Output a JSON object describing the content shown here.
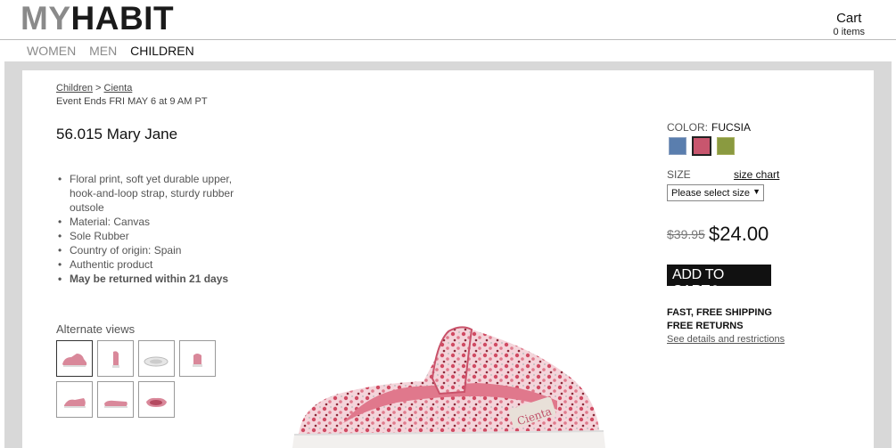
{
  "header": {
    "logo_my": "MY",
    "logo_habit": "HABIT",
    "cart_title": "Cart",
    "cart_count": "0 items"
  },
  "nav": [
    "WOMEN",
    "MEN",
    "CHILDREN"
  ],
  "nav_active": "CHILDREN",
  "breadcrumb": {
    "part1": "Children",
    "separator": " > ",
    "part2": "Cienta"
  },
  "event_ends": "Event Ends FRI MAY 6 at 9 AM PT",
  "product": {
    "title": "56.015 Mary Jane",
    "features": [
      "Floral print, soft yet durable upper, hook-and-loop strap, sturdy rubber outsole",
      "Material: Canvas",
      "Sole Rubber",
      "Country of origin: Spain",
      "Authentic product",
      "May be returned within 21 days"
    ],
    "alternate_views_label": "Alternate views",
    "brand_mark": "Cienta"
  },
  "purchase": {
    "color_label": "COLOR:",
    "color_value": "FUCSIA",
    "swatch_colors": [
      "#5a7eae",
      "#c8566e",
      "#8a9a40"
    ],
    "size_label": "SIZE",
    "size_chart": "size chart",
    "size_select": "Please select size",
    "old_price": "$39.95",
    "new_price": "$24.00",
    "add_to_cart": "ADD TO CART",
    "shipping_line1": "FAST, FREE SHIPPING",
    "shipping_line2": "FREE RETURNS",
    "details_link": "See details and restrictions"
  }
}
